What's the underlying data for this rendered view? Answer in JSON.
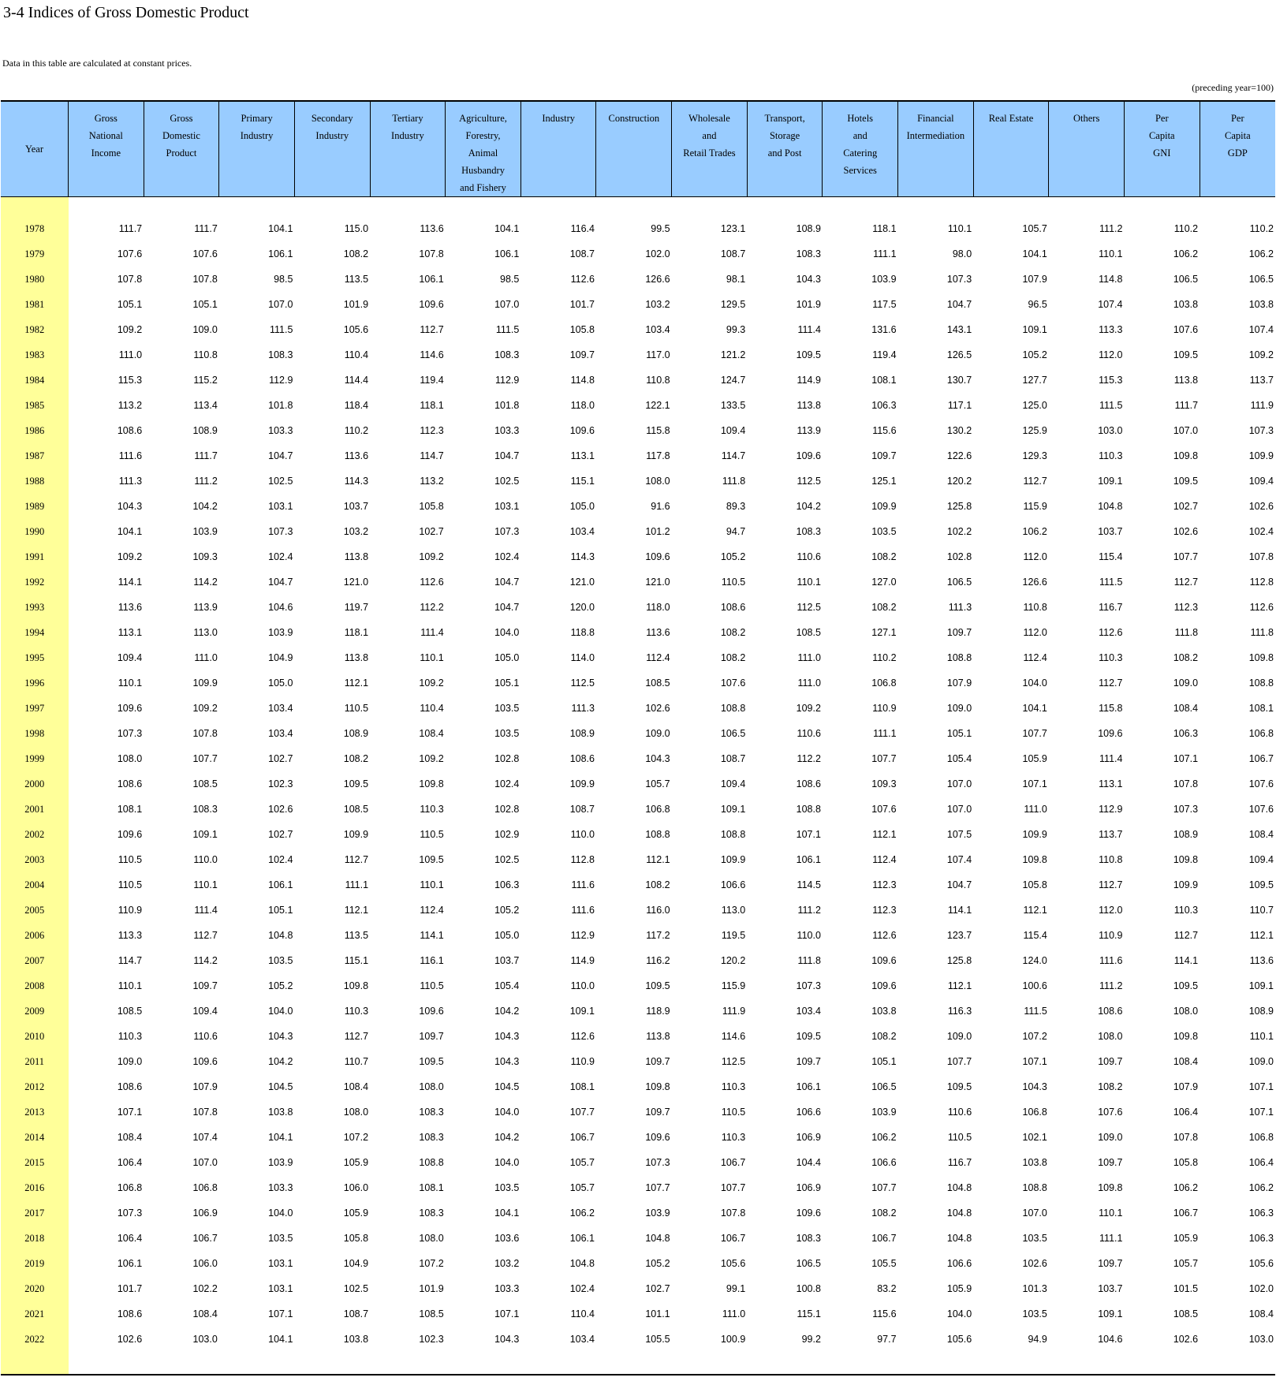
{
  "title": "3-4  Indices of Gross Domestic Product",
  "note": "Data in this table are calculated at constant prices.",
  "unit": "(preceding year=100)",
  "columns": [
    [
      "Year"
    ],
    [
      "Gross",
      "National",
      "Income"
    ],
    [
      "Gross",
      "Domestic",
      "Product"
    ],
    [
      "Primary",
      "Industry"
    ],
    [
      "Secondary",
      "Industry"
    ],
    [
      "Tertiary",
      "Industry"
    ],
    [
      "Agriculture,",
      "Forestry,",
      "Animal Husbandry",
      "and Fishery"
    ],
    [
      "Industry"
    ],
    [
      "Construction"
    ],
    [
      "Wholesale",
      "and",
      "Retail Trades"
    ],
    [
      "Transport,",
      "Storage",
      "and Post"
    ],
    [
      "Hotels",
      "and",
      "Catering",
      "Services"
    ],
    [
      "Financial",
      "Intermediation"
    ],
    [
      "Real Estate"
    ],
    [
      "Others"
    ],
    [
      "Per",
      "Capita",
      "GNI"
    ],
    [
      "Per",
      "Capita",
      "GDP"
    ]
  ],
  "rows": [
    [
      "1978",
      "111.7",
      "111.7",
      "104.1",
      "115.0",
      "113.6",
      "104.1",
      "116.4",
      "99.5",
      "123.1",
      "108.9",
      "118.1",
      "110.1",
      "105.7",
      "111.2",
      "110.2",
      "110.2"
    ],
    [
      "1979",
      "107.6",
      "107.6",
      "106.1",
      "108.2",
      "107.8",
      "106.1",
      "108.7",
      "102.0",
      "108.7",
      "108.3",
      "111.1",
      "98.0",
      "104.1",
      "110.1",
      "106.2",
      "106.2"
    ],
    [
      "1980",
      "107.8",
      "107.8",
      "98.5",
      "113.5",
      "106.1",
      "98.5",
      "112.6",
      "126.6",
      "98.1",
      "104.3",
      "103.9",
      "107.3",
      "107.9",
      "114.8",
      "106.5",
      "106.5"
    ],
    [
      "1981",
      "105.1",
      "105.1",
      "107.0",
      "101.9",
      "109.6",
      "107.0",
      "101.7",
      "103.2",
      "129.5",
      "101.9",
      "117.5",
      "104.7",
      "96.5",
      "107.4",
      "103.8",
      "103.8"
    ],
    [
      "1982",
      "109.2",
      "109.0",
      "111.5",
      "105.6",
      "112.7",
      "111.5",
      "105.8",
      "103.4",
      "99.3",
      "111.4",
      "131.6",
      "143.1",
      "109.1",
      "113.3",
      "107.6",
      "107.4"
    ],
    [
      "1983",
      "111.0",
      "110.8",
      "108.3",
      "110.4",
      "114.6",
      "108.3",
      "109.7",
      "117.0",
      "121.2",
      "109.5",
      "119.4",
      "126.5",
      "105.2",
      "112.0",
      "109.5",
      "109.2"
    ],
    [
      "1984",
      "115.3",
      "115.2",
      "112.9",
      "114.4",
      "119.4",
      "112.9",
      "114.8",
      "110.8",
      "124.7",
      "114.9",
      "108.1",
      "130.7",
      "127.7",
      "115.3",
      "113.8",
      "113.7"
    ],
    [
      "1985",
      "113.2",
      "113.4",
      "101.8",
      "118.4",
      "118.1",
      "101.8",
      "118.0",
      "122.1",
      "133.5",
      "113.8",
      "106.3",
      "117.1",
      "125.0",
      "111.5",
      "111.7",
      "111.9"
    ],
    [
      "1986",
      "108.6",
      "108.9",
      "103.3",
      "110.2",
      "112.3",
      "103.3",
      "109.6",
      "115.8",
      "109.4",
      "113.9",
      "115.6",
      "130.2",
      "125.9",
      "103.0",
      "107.0",
      "107.3"
    ],
    [
      "1987",
      "111.6",
      "111.7",
      "104.7",
      "113.6",
      "114.7",
      "104.7",
      "113.1",
      "117.8",
      "114.7",
      "109.6",
      "109.7",
      "122.6",
      "129.3",
      "110.3",
      "109.8",
      "109.9"
    ],
    [
      "1988",
      "111.3",
      "111.2",
      "102.5",
      "114.3",
      "113.2",
      "102.5",
      "115.1",
      "108.0",
      "111.8",
      "112.5",
      "125.1",
      "120.2",
      "112.7",
      "109.1",
      "109.5",
      "109.4"
    ],
    [
      "1989",
      "104.3",
      "104.2",
      "103.1",
      "103.7",
      "105.8",
      "103.1",
      "105.0",
      "91.6",
      "89.3",
      "104.2",
      "109.9",
      "125.8",
      "115.9",
      "104.8",
      "102.7",
      "102.6"
    ],
    [
      "1990",
      "104.1",
      "103.9",
      "107.3",
      "103.2",
      "102.7",
      "107.3",
      "103.4",
      "101.2",
      "94.7",
      "108.3",
      "103.5",
      "102.2",
      "106.2",
      "103.7",
      "102.6",
      "102.4"
    ],
    [
      "1991",
      "109.2",
      "109.3",
      "102.4",
      "113.8",
      "109.2",
      "102.4",
      "114.3",
      "109.6",
      "105.2",
      "110.6",
      "108.2",
      "102.8",
      "112.0",
      "115.4",
      "107.7",
      "107.8"
    ],
    [
      "1992",
      "114.1",
      "114.2",
      "104.7",
      "121.0",
      "112.6",
      "104.7",
      "121.0",
      "121.0",
      "110.5",
      "110.1",
      "127.0",
      "106.5",
      "126.6",
      "111.5",
      "112.7",
      "112.8"
    ],
    [
      "1993",
      "113.6",
      "113.9",
      "104.6",
      "119.7",
      "112.2",
      "104.7",
      "120.0",
      "118.0",
      "108.6",
      "112.5",
      "108.2",
      "111.3",
      "110.8",
      "116.7",
      "112.3",
      "112.6"
    ],
    [
      "1994",
      "113.1",
      "113.0",
      "103.9",
      "118.1",
      "111.4",
      "104.0",
      "118.8",
      "113.6",
      "108.2",
      "108.5",
      "127.1",
      "109.7",
      "112.0",
      "112.6",
      "111.8",
      "111.8"
    ],
    [
      "1995",
      "109.4",
      "111.0",
      "104.9",
      "113.8",
      "110.1",
      "105.0",
      "114.0",
      "112.4",
      "108.2",
      "111.0",
      "110.2",
      "108.8",
      "112.4",
      "110.3",
      "108.2",
      "109.8"
    ],
    [
      "1996",
      "110.1",
      "109.9",
      "105.0",
      "112.1",
      "109.2",
      "105.1",
      "112.5",
      "108.5",
      "107.6",
      "111.0",
      "106.8",
      "107.9",
      "104.0",
      "112.7",
      "109.0",
      "108.8"
    ],
    [
      "1997",
      "109.6",
      "109.2",
      "103.4",
      "110.5",
      "110.4",
      "103.5",
      "111.3",
      "102.6",
      "108.8",
      "109.2",
      "110.9",
      "109.0",
      "104.1",
      "115.8",
      "108.4",
      "108.1"
    ],
    [
      "1998",
      "107.3",
      "107.8",
      "103.4",
      "108.9",
      "108.4",
      "103.5",
      "108.9",
      "109.0",
      "106.5",
      "110.6",
      "111.1",
      "105.1",
      "107.7",
      "109.6",
      "106.3",
      "106.8"
    ],
    [
      "1999",
      "108.0",
      "107.7",
      "102.7",
      "108.2",
      "109.2",
      "102.8",
      "108.6",
      "104.3",
      "108.7",
      "112.2",
      "107.7",
      "105.4",
      "105.9",
      "111.4",
      "107.1",
      "106.7"
    ],
    [
      "2000",
      "108.6",
      "108.5",
      "102.3",
      "109.5",
      "109.8",
      "102.4",
      "109.9",
      "105.7",
      "109.4",
      "108.6",
      "109.3",
      "107.0",
      "107.1",
      "113.1",
      "107.8",
      "107.6"
    ],
    [
      "2001",
      "108.1",
      "108.3",
      "102.6",
      "108.5",
      "110.3",
      "102.8",
      "108.7",
      "106.8",
      "109.1",
      "108.8",
      "107.6",
      "107.0",
      "111.0",
      "112.9",
      "107.3",
      "107.6"
    ],
    [
      "2002",
      "109.6",
      "109.1",
      "102.7",
      "109.9",
      "110.5",
      "102.9",
      "110.0",
      "108.8",
      "108.8",
      "107.1",
      "112.1",
      "107.5",
      "109.9",
      "113.7",
      "108.9",
      "108.4"
    ],
    [
      "2003",
      "110.5",
      "110.0",
      "102.4",
      "112.7",
      "109.5",
      "102.5",
      "112.8",
      "112.1",
      "109.9",
      "106.1",
      "112.4",
      "107.4",
      "109.8",
      "110.8",
      "109.8",
      "109.4"
    ],
    [
      "2004",
      "110.5",
      "110.1",
      "106.1",
      "111.1",
      "110.1",
      "106.3",
      "111.6",
      "108.2",
      "106.6",
      "114.5",
      "112.3",
      "104.7",
      "105.8",
      "112.7",
      "109.9",
      "109.5"
    ],
    [
      "2005",
      "110.9",
      "111.4",
      "105.1",
      "112.1",
      "112.4",
      "105.2",
      "111.6",
      "116.0",
      "113.0",
      "111.2",
      "112.3",
      "114.1",
      "112.1",
      "112.0",
      "110.3",
      "110.7"
    ],
    [
      "2006",
      "113.3",
      "112.7",
      "104.8",
      "113.5",
      "114.1",
      "105.0",
      "112.9",
      "117.2",
      "119.5",
      "110.0",
      "112.6",
      "123.7",
      "115.4",
      "110.9",
      "112.7",
      "112.1"
    ],
    [
      "2007",
      "114.7",
      "114.2",
      "103.5",
      "115.1",
      "116.1",
      "103.7",
      "114.9",
      "116.2",
      "120.2",
      "111.8",
      "109.6",
      "125.8",
      "124.0",
      "111.6",
      "114.1",
      "113.6"
    ],
    [
      "2008",
      "110.1",
      "109.7",
      "105.2",
      "109.8",
      "110.5",
      "105.4",
      "110.0",
      "109.5",
      "115.9",
      "107.3",
      "109.6",
      "112.1",
      "100.6",
      "111.2",
      "109.5",
      "109.1"
    ],
    [
      "2009",
      "108.5",
      "109.4",
      "104.0",
      "110.3",
      "109.6",
      "104.2",
      "109.1",
      "118.9",
      "111.9",
      "103.4",
      "103.8",
      "116.3",
      "111.5",
      "108.6",
      "108.0",
      "108.9"
    ],
    [
      "2010",
      "110.3",
      "110.6",
      "104.3",
      "112.7",
      "109.7",
      "104.3",
      "112.6",
      "113.8",
      "114.6",
      "109.5",
      "108.2",
      "109.0",
      "107.2",
      "108.0",
      "109.8",
      "110.1"
    ],
    [
      "2011",
      "109.0",
      "109.6",
      "104.2",
      "110.7",
      "109.5",
      "104.3",
      "110.9",
      "109.7",
      "112.5",
      "109.7",
      "105.1",
      "107.7",
      "107.1",
      "109.7",
      "108.4",
      "109.0"
    ],
    [
      "2012",
      "108.6",
      "107.9",
      "104.5",
      "108.4",
      "108.0",
      "104.5",
      "108.1",
      "109.8",
      "110.3",
      "106.1",
      "106.5",
      "109.5",
      "104.3",
      "108.2",
      "107.9",
      "107.1"
    ],
    [
      "2013",
      "107.1",
      "107.8",
      "103.8",
      "108.0",
      "108.3",
      "104.0",
      "107.7",
      "109.7",
      "110.5",
      "106.6",
      "103.9",
      "110.6",
      "106.8",
      "107.6",
      "106.4",
      "107.1"
    ],
    [
      "2014",
      "108.4",
      "107.4",
      "104.1",
      "107.2",
      "108.3",
      "104.2",
      "106.7",
      "109.6",
      "110.3",
      "106.9",
      "106.2",
      "110.5",
      "102.1",
      "109.0",
      "107.8",
      "106.8"
    ],
    [
      "2015",
      "106.4",
      "107.0",
      "103.9",
      "105.9",
      "108.8",
      "104.0",
      "105.7",
      "107.3",
      "106.7",
      "104.4",
      "106.6",
      "116.7",
      "103.8",
      "109.7",
      "105.8",
      "106.4"
    ],
    [
      "2016",
      "106.8",
      "106.8",
      "103.3",
      "106.0",
      "108.1",
      "103.5",
      "105.7",
      "107.7",
      "107.7",
      "106.9",
      "107.7",
      "104.8",
      "108.8",
      "109.8",
      "106.2",
      "106.2"
    ],
    [
      "2017",
      "107.3",
      "106.9",
      "104.0",
      "105.9",
      "108.3",
      "104.1",
      "106.2",
      "103.9",
      "107.8",
      "109.6",
      "108.2",
      "104.8",
      "107.0",
      "110.1",
      "106.7",
      "106.3"
    ],
    [
      "2018",
      "106.4",
      "106.7",
      "103.5",
      "105.8",
      "108.0",
      "103.6",
      "106.1",
      "104.8",
      "106.7",
      "108.3",
      "106.7",
      "104.8",
      "103.5",
      "111.1",
      "105.9",
      "106.3"
    ],
    [
      "2019",
      "106.1",
      "106.0",
      "103.1",
      "104.9",
      "107.2",
      "103.2",
      "104.8",
      "105.2",
      "105.6",
      "106.5",
      "105.5",
      "106.6",
      "102.6",
      "109.7",
      "105.7",
      "105.6"
    ],
    [
      "2020",
      "101.7",
      "102.2",
      "103.1",
      "102.5",
      "101.9",
      "103.3",
      "102.4",
      "102.7",
      "99.1",
      "100.8",
      "83.2",
      "105.9",
      "101.3",
      "103.7",
      "101.5",
      "102.0"
    ],
    [
      "2021",
      "108.6",
      "108.4",
      "107.1",
      "108.7",
      "108.5",
      "107.1",
      "110.4",
      "101.1",
      "111.0",
      "115.1",
      "115.6",
      "104.0",
      "103.5",
      "109.1",
      "108.5",
      "108.4"
    ],
    [
      "2022",
      "102.6",
      "103.0",
      "104.1",
      "103.8",
      "102.3",
      "104.3",
      "103.4",
      "105.5",
      "100.9",
      "99.2",
      "97.7",
      "105.6",
      "94.9",
      "104.6",
      "102.6",
      "103.0"
    ]
  ]
}
